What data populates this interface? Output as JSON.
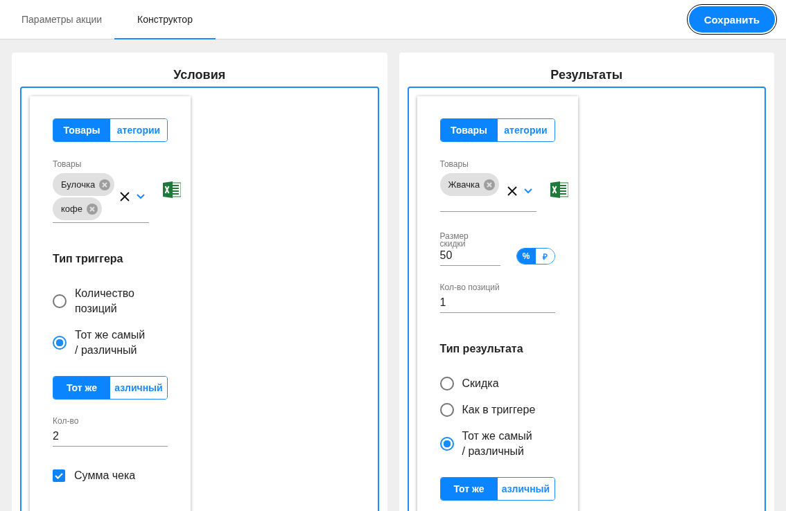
{
  "tabs": [
    {
      "label": "Параметры акции",
      "selected": false
    },
    {
      "label": "Конструктор",
      "selected": true
    }
  ],
  "save_button": "Сохранить",
  "panels": [
    {
      "title": "Условия",
      "items": [
        {
          "kind": "segmented",
          "options": [
            {
              "label": "Товары",
              "selected": true
            },
            {
              "label": "атегории",
              "selected": false
            }
          ]
        },
        {
          "kind": "multiselect",
          "label": "Товары",
          "chips": [
            "Булочка",
            "кофе"
          ]
        },
        {
          "kind": "heading",
          "text": "Тип триггера"
        },
        {
          "kind": "radio",
          "label": "Количество позиций",
          "selected": false
        },
        {
          "kind": "radio",
          "label": "Тот же самый / различный",
          "selected": true
        },
        {
          "kind": "segmented",
          "options": [
            {
              "label": "Тот же",
              "selected": true
            },
            {
              "label": "азличный",
              "selected": false
            }
          ]
        },
        {
          "kind": "field",
          "label": "Кол-во",
          "value": "2"
        },
        {
          "kind": "checkbox",
          "label": "Сумма чека",
          "checked": true
        }
      ]
    },
    {
      "title": "Результаты",
      "items": [
        {
          "kind": "segmented",
          "options": [
            {
              "label": "Товары",
              "selected": true
            },
            {
              "label": "атегории",
              "selected": false
            }
          ]
        },
        {
          "kind": "multiselect",
          "label": "Товары",
          "chips": [
            "Жвачка"
          ]
        },
        {
          "kind": "discount",
          "label": "Размер скидки",
          "value": "50",
          "units": [
            {
              "label": "%",
              "selected": true
            },
            {
              "label": "₽",
              "selected": false
            }
          ]
        },
        {
          "kind": "field",
          "label": "Кол-во позиций",
          "value": "1"
        },
        {
          "kind": "heading",
          "text": "Тип результата"
        },
        {
          "kind": "radio",
          "label": "Скидка",
          "selected": false
        },
        {
          "kind": "radio",
          "label": "Как в триггере",
          "selected": false
        },
        {
          "kind": "radio",
          "label": "Тот же самый / различный",
          "selected": true
        },
        {
          "kind": "segmented",
          "options": [
            {
              "label": "Тот же",
              "selected": true
            },
            {
              "label": "азличный",
              "selected": false
            }
          ]
        }
      ]
    }
  ]
}
